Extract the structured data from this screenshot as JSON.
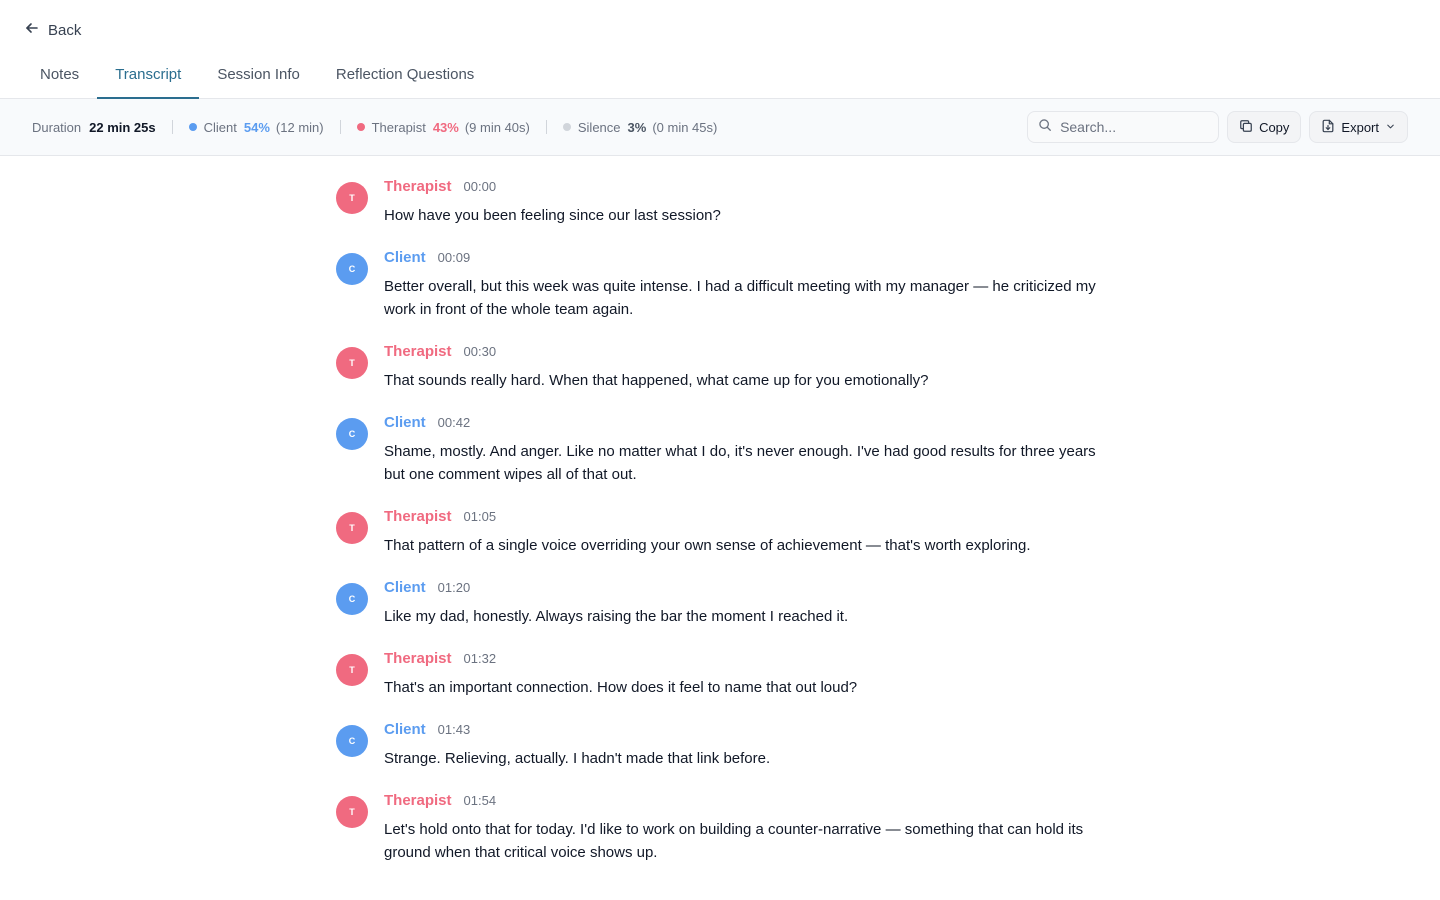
{
  "nav": {
    "back_label": "Back"
  },
  "tabs": [
    {
      "label": "Notes",
      "active": false
    },
    {
      "label": "Transcript",
      "active": true
    },
    {
      "label": "Session Info",
      "active": false
    },
    {
      "label": "Reflection Questions",
      "active": false
    }
  ],
  "stats": {
    "duration_label": "Duration",
    "duration_value": "22 min 25s",
    "client": {
      "label": "Client",
      "pct": "54%",
      "time": "(12 min)",
      "color": "#5b9cf0"
    },
    "therapist": {
      "label": "Therapist",
      "pct": "43%",
      "time": "(9 min 40s)",
      "color": "#f06a80"
    },
    "silence": {
      "label": "Silence",
      "pct": "3%",
      "time": "(0 min 45s)",
      "color": "#d1d5db"
    }
  },
  "toolbar": {
    "search_placeholder": "Search...",
    "copy_label": "Copy",
    "export_label": "Export"
  },
  "colors": {
    "accent": "#2b6e8f",
    "therapist": "#f06a80",
    "client": "#5b9cf0"
  },
  "messages": [
    {
      "role": "therapist",
      "speaker": "Therapist",
      "initial": "T",
      "time": "00:00",
      "text": "How have you been feeling since our last session?"
    },
    {
      "role": "client",
      "speaker": "Client",
      "initial": "C",
      "time": "00:09",
      "text": "Better overall, but this week was quite intense. I had a difficult meeting with my manager — he criticized my work in front of the whole team again."
    },
    {
      "role": "therapist",
      "speaker": "Therapist",
      "initial": "T",
      "time": "00:30",
      "text": "That sounds really hard. When that happened, what came up for you emotionally?"
    },
    {
      "role": "client",
      "speaker": "Client",
      "initial": "C",
      "time": "00:42",
      "text": "Shame, mostly. And anger. Like no matter what I do, it's never enough. I've had good results for three years but one comment wipes all of that out."
    },
    {
      "role": "therapist",
      "speaker": "Therapist",
      "initial": "T",
      "time": "01:05",
      "text": "That pattern of a single voice overriding your own sense of achievement — that's worth exploring."
    },
    {
      "role": "client",
      "speaker": "Client",
      "initial": "C",
      "time": "01:20",
      "text": "Like my dad, honestly. Always raising the bar the moment I reached it."
    },
    {
      "role": "therapist",
      "speaker": "Therapist",
      "initial": "T",
      "time": "01:32",
      "text": "That's an important connection. How does it feel to name that out loud?"
    },
    {
      "role": "client",
      "speaker": "Client",
      "initial": "C",
      "time": "01:43",
      "text": "Strange. Relieving, actually. I hadn't made that link before."
    },
    {
      "role": "therapist",
      "speaker": "Therapist",
      "initial": "T",
      "time": "01:54",
      "text": "Let's hold onto that for today. I'd like to work on building a counter-narrative — something that can hold its ground when that critical voice shows up."
    }
  ]
}
